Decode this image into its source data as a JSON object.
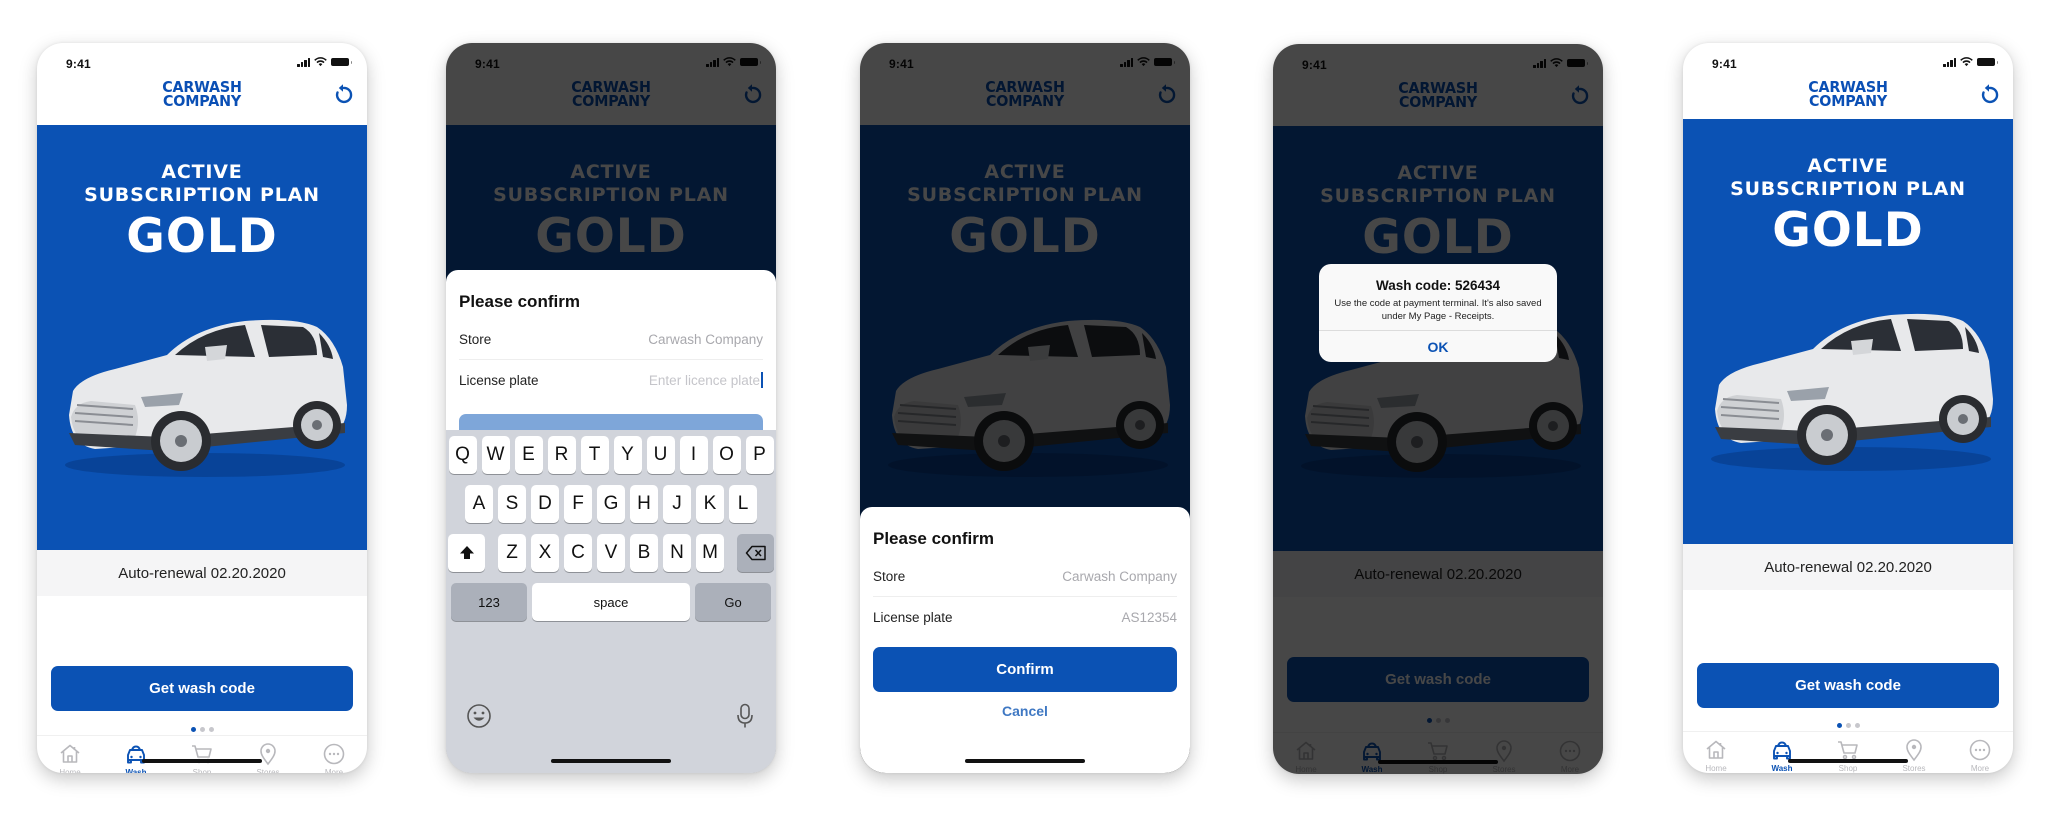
{
  "brand": {
    "line1": "CARWASH",
    "line2": "COMPANY",
    "accent": "#0b52b4"
  },
  "status_bar": {
    "time": "9:41"
  },
  "banner": {
    "line1": "ACTIVE",
    "line2": "SUBSCRIPTION PLAN",
    "plan": "GOLD"
  },
  "renewal_text": "Auto-renewal 02.20.2020",
  "primary_button": "Get wash code",
  "pager": {
    "pages": 3,
    "active": 1
  },
  "tabs": [
    {
      "label": "Home",
      "icon": "home-icon"
    },
    {
      "label": "Wash",
      "icon": "car-icon",
      "active": true
    },
    {
      "label": "Shop",
      "icon": "cart-icon"
    },
    {
      "label": "Stores",
      "icon": "location-pin-icon"
    },
    {
      "label": "More",
      "icon": "more-icon"
    }
  ],
  "confirm_sheet": {
    "title": "Please confirm",
    "store_label": "Store",
    "store_value": "Carwash Company",
    "plate_label": "License plate",
    "plate_placeholder": "Enter licence plate",
    "plate_value": "AS12354",
    "confirm_label": "Confirm",
    "cancel_label": "Cancel"
  },
  "keyboard": {
    "row1": [
      "Q",
      "W",
      "E",
      "R",
      "T",
      "Y",
      "U",
      "I",
      "O",
      "P"
    ],
    "row2": [
      "A",
      "S",
      "D",
      "F",
      "G",
      "H",
      "J",
      "K",
      "L"
    ],
    "row3": [
      "Z",
      "X",
      "C",
      "V",
      "B",
      "N",
      "M"
    ],
    "numbers_label": "123",
    "space_label": "space",
    "go_label": "Go"
  },
  "alert": {
    "title": "Wash code: 526434",
    "message": "Use the code at payment terminal. It's also saved under My Page - Receipts.",
    "ok_label": "OK"
  }
}
